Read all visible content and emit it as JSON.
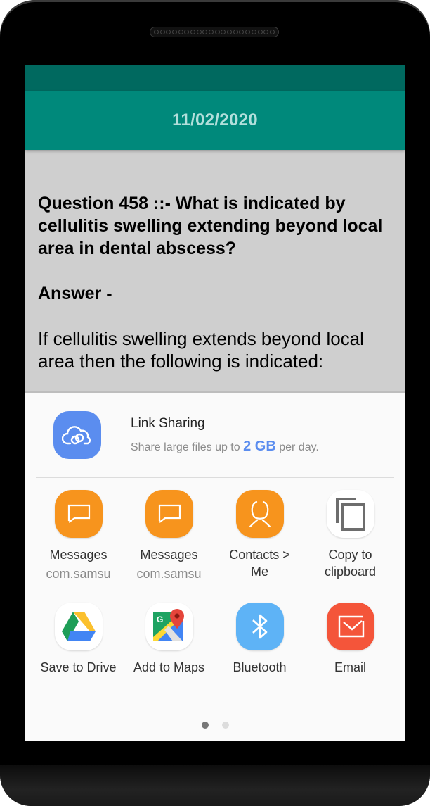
{
  "appbar": {
    "title": "11/02/2020"
  },
  "content": {
    "question": "Question 458 ::-   What is indicated by cellulitis swelling extending beyond local area in dental abscess?",
    "answer_label": "Answer -",
    "answer_text": "If cellulitis swelling extends beyond local area then the following is indicated:"
  },
  "share_sheet": {
    "link_sharing": {
      "title": "Link Sharing",
      "subtitle_prefix": "Share large files up to ",
      "subtitle_highlight": "2 GB",
      "subtitle_suffix": " per day.",
      "icon": "cloud-link-icon",
      "accent": "#5b8def"
    },
    "apps": [
      {
        "label": "Messages",
        "sub": "com.samsu",
        "icon": "message-icon",
        "color": "#f7941d"
      },
      {
        "label": "Messages",
        "sub": "com.samsu",
        "icon": "message-icon",
        "color": "#f7941d"
      },
      {
        "label": "Contacts >\nMe",
        "sub": "",
        "icon": "contact-icon",
        "color": "#f7941d"
      },
      {
        "label": "Copy to\nclipboard",
        "sub": "",
        "icon": "copy-icon",
        "color": "#ffffff"
      },
      {
        "label": "Save to Drive",
        "sub": "",
        "icon": "google-drive-icon",
        "color": "#ffffff"
      },
      {
        "label": "Add to Maps",
        "sub": "",
        "icon": "google-maps-icon",
        "color": "#ffffff"
      },
      {
        "label": "Bluetooth",
        "sub": "",
        "icon": "bluetooth-icon",
        "color": "#5eb3f6"
      },
      {
        "label": "Email",
        "sub": "",
        "icon": "email-icon",
        "color": "#f4553a"
      }
    ],
    "page_indicator": {
      "current": 1,
      "total": 2
    }
  },
  "colors": {
    "status_bar": "#00695f",
    "app_bar": "#00897b",
    "app_bar_text": "#b2dfdb",
    "content_bg": "#cfcfcf"
  }
}
